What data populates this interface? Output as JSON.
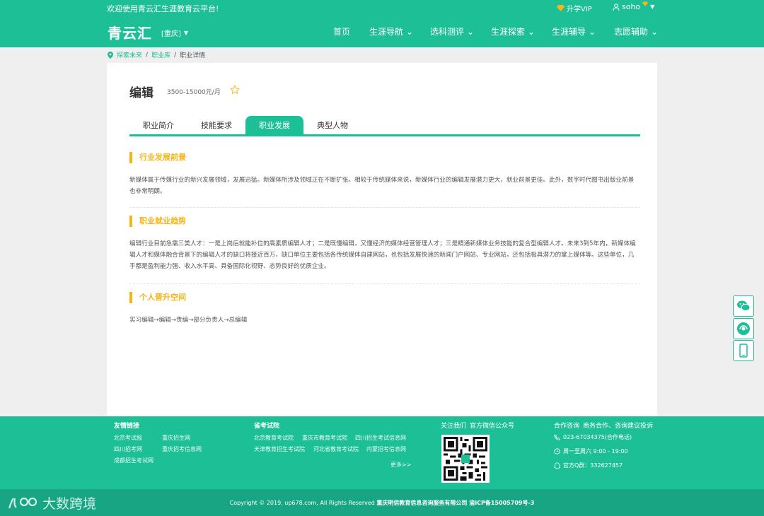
{
  "colors": {
    "brand": "#1dbf97",
    "brand_dark": "#17a583",
    "accent": "#f6b417"
  },
  "topbar": {
    "welcome": "欢迎使用青云汇生涯教育云平台!",
    "vip_label": "升学VIP",
    "username": "soho"
  },
  "header": {
    "logo": "青云汇",
    "city": "[重庆]",
    "nav": [
      "首页",
      "生涯导航",
      "选科测评",
      "生涯探索",
      "生涯辅导",
      "志愿辅助"
    ]
  },
  "breadcrumb": [
    "探索未来",
    "职业库",
    "职业详情"
  ],
  "job": {
    "title": "编辑",
    "salary": "3500-15000元/月"
  },
  "tabs": [
    "职业简介",
    "技能要求",
    "职业发展",
    "典型人物"
  ],
  "active_tab": "职业发展",
  "sections": [
    {
      "heading": "行业发展前景",
      "body": "新媒体属于传媒行业的新兴发展领域，发展迅猛。新媒体所涉及领域正在不断扩张。相较于传统媒体来说，新媒体行业的编辑发展潜力更大，就业前景更佳。此外，数字时代图书出版业前景也非常明朗。"
    },
    {
      "heading": "职业就业趋势",
      "body": "编辑行业目前急需三类人才：一是上岗后就能补位的高素质编辑人才；二是既懂编辑，又懂经济的媒体经营管理人才；三是精通新媒体业务技能的复合型编辑人才。未来3到5年内，新媒体编辑人才和媒体融合背景下的编辑人才的缺口将接近百万，缺口单位主要包括各传统媒体自建网站，也包括发展快速的新闻门户网站、专业网站，还包括极具潜力的掌上媒体等。这些单位，几乎都是盈利能力强、收入水平高、具备国际化视野、态势良好的优质企业。"
    },
    {
      "heading": "个人晋升空间",
      "body": "实习编辑→编辑→责编→部分负责人→总编辑"
    }
  ],
  "footer": {
    "friends": {
      "title": "友情链接",
      "links": [
        "北京考试报",
        "重庆招生网",
        "四川招考网",
        "重庆招考信息网",
        "成都招生考试网"
      ]
    },
    "exams": {
      "title": "省考试院",
      "links": [
        "北京教育考试院",
        "重庆市教育考试院",
        "四川招生考试信息网",
        "天津教育招生考试院",
        "河北省教育考试院",
        "内蒙招考信息网"
      ],
      "more": "更多>>"
    },
    "follow": {
      "title": "关注我们",
      "subtitle": "官方微信公众号"
    },
    "contact": {
      "title": "合作咨询",
      "subtitle": "商务合作、咨询建议投诉",
      "phone": "023-67034375(合作电话)",
      "hours": "周一至周六 9:00 - 19:00",
      "qq": "官方Q群：332627457"
    },
    "copyright": "Copyright © 2019, up678.com, All Rights Reserved",
    "company": "重庆明信教育信息咨询服务有限公司 渝ICP备15005709号-3"
  },
  "watermark": "大数跨境"
}
